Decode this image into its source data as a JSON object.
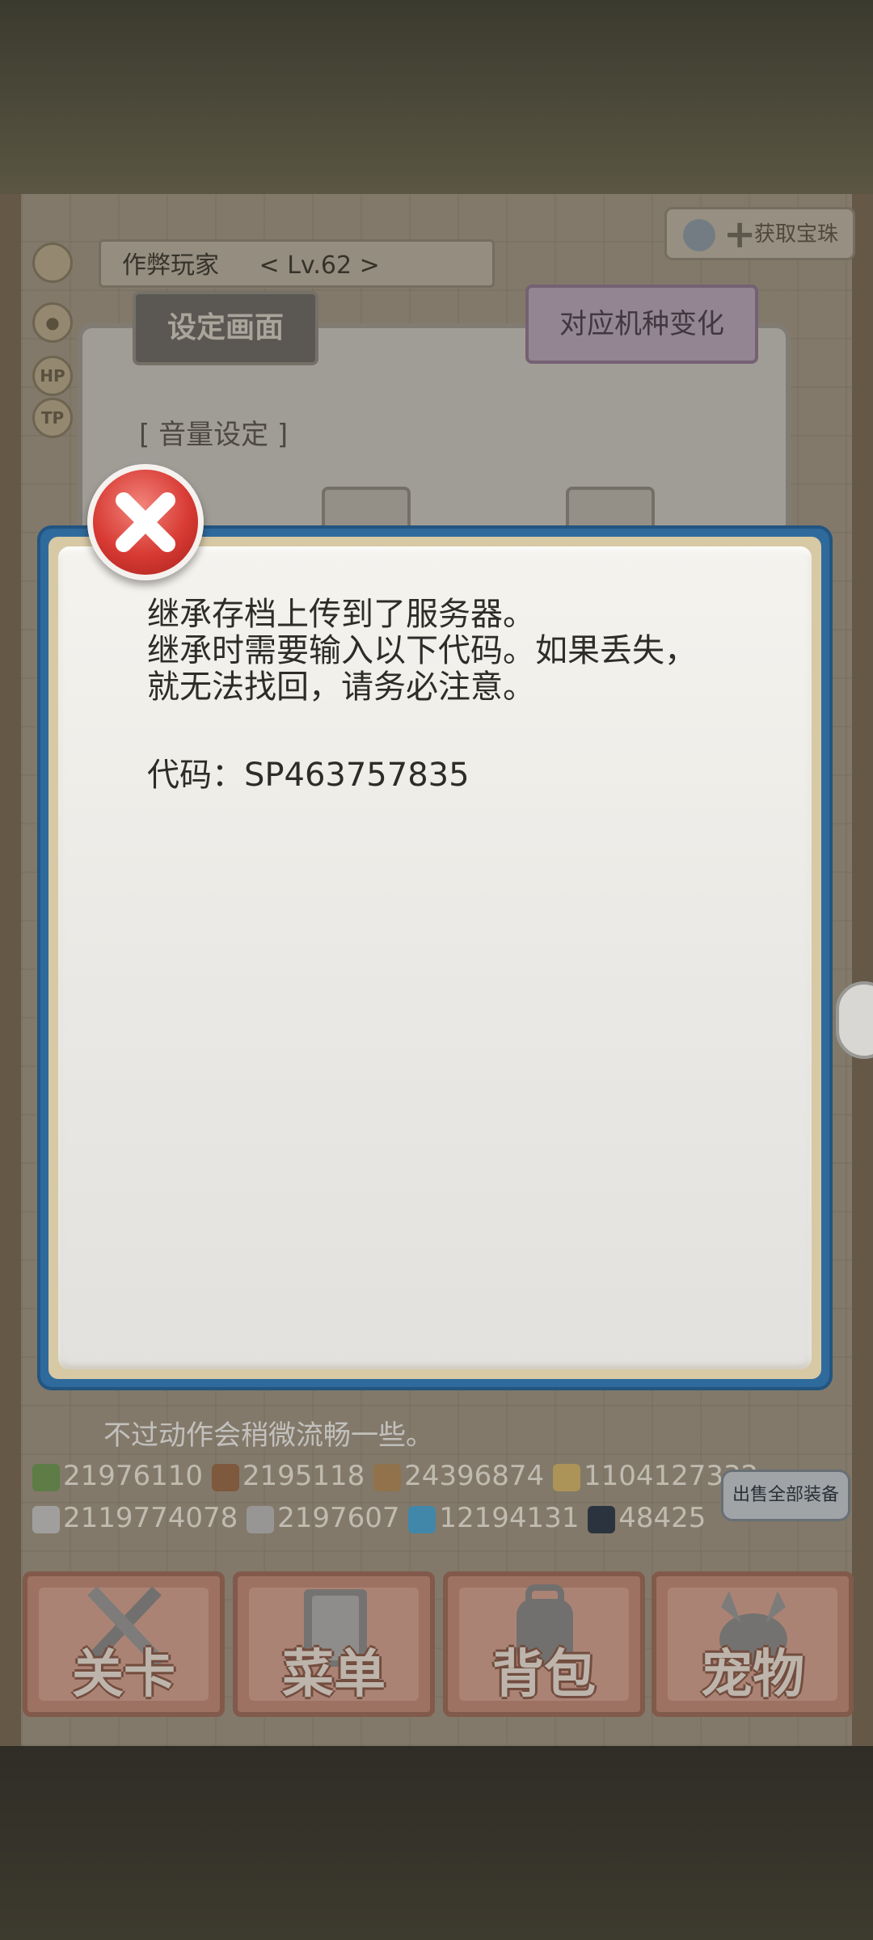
{
  "hud": {
    "player_name": "作弊玩家",
    "player_level": "< Lv.62 >",
    "hp_label": "HP",
    "tp_label": "TP",
    "add_gem_label": "获取宝珠"
  },
  "settings_panel": {
    "tab_settings": "设定画面",
    "tab_device": "对应机种变化",
    "volume_label": "[ 音量设定 ]"
  },
  "dialog": {
    "lines": [
      "继承存档上传到了服务器。",
      "继承时需要输入以下代码。如果丢失，",
      "就无法找回，请务必注意。"
    ],
    "code_line": "代码：SP463757835"
  },
  "background_hint": {
    "line2": "不过动作会稍微流畅一些。"
  },
  "resources": {
    "row1": [
      "21976110",
      "2195118",
      "24396874",
      "1104127332"
    ],
    "row2": [
      "2119774078",
      "2197607",
      "12194131",
      "48425"
    ]
  },
  "sell_all_label": "出售全部装备",
  "nav": [
    {
      "label": "关卡",
      "icon": "crossed-swords-icon"
    },
    {
      "label": "菜单",
      "icon": "book-icon"
    },
    {
      "label": "背包",
      "icon": "backpack-icon"
    },
    {
      "label": "宠物",
      "icon": "dragon-icon"
    }
  ],
  "colors": {
    "dialog_border": "#2f6a9c",
    "close_button": "#d73a33"
  }
}
